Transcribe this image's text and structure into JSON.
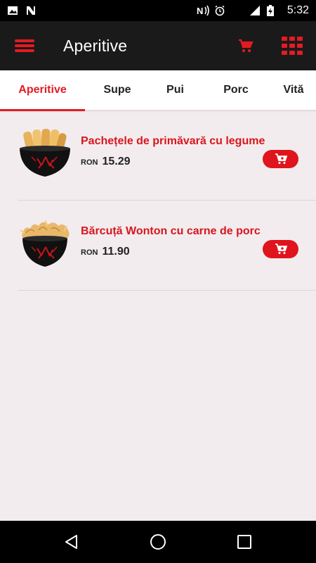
{
  "status_bar": {
    "time": "5:32",
    "icons": [
      "image-icon",
      "n-notification-icon",
      "nfc-icon",
      "alarm-icon",
      "wifi-icon",
      "signal-roaming-icon",
      "battery-charging-icon"
    ]
  },
  "app_bar": {
    "title": "Aperitive",
    "icons": [
      "hamburger-menu-icon",
      "cart-icon",
      "grid-icon"
    ],
    "accent": "#e31b23"
  },
  "tabs": [
    {
      "label": "Aperitive",
      "active": true
    },
    {
      "label": "Supe",
      "active": false
    },
    {
      "label": "Pui",
      "active": false
    },
    {
      "label": "Porc",
      "active": false
    },
    {
      "label": "Vită",
      "active": false
    }
  ],
  "items": [
    {
      "name": "Pachețele de primăvară cu legume",
      "currency": "RON",
      "price": "15.29",
      "image": "spring-rolls-bowl"
    },
    {
      "name": "Bărcuță Wonton cu carne de porc",
      "currency": "RON",
      "price": "11.90",
      "image": "wonton-bowl"
    }
  ],
  "nav_bar": {
    "icons": [
      "back-icon",
      "home-icon",
      "recents-icon"
    ]
  }
}
